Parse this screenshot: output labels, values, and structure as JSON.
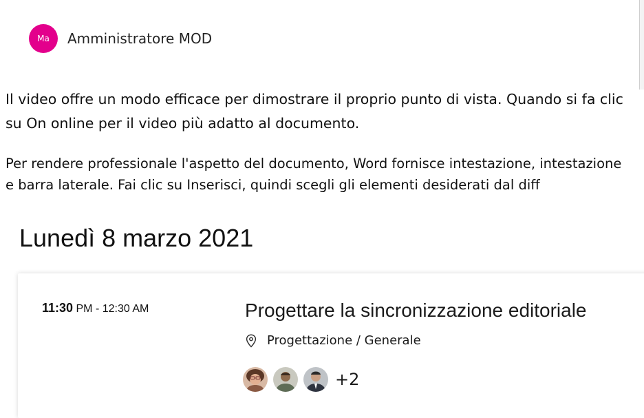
{
  "post": {
    "author": {
      "initials": "Ma",
      "name": "Amministratore MOD",
      "avatar_color": "#e3008c"
    },
    "paragraphs": [
      "Il video offre un modo efficace per dimostrare il proprio punto di vista. Quando si fa clic su On online per il video più adatto al documento.",
      "Per rendere professionale l'aspetto del documento, Word fornisce intestazione, intestazione e barra laterale. Fai clic su Inserisci, quindi scegli gli elementi desiderati dal diff"
    ]
  },
  "agenda": {
    "day": "Lunedì 8 marzo 2021",
    "event": {
      "start": "11:30",
      "start_suffix": "PM -",
      "end": "12:30 AM",
      "title": "Progettare la sincronizzazione editoriale",
      "location_icon": "location-pin-icon",
      "location": "Progettazione / Generale",
      "more_attendees": "+2"
    }
  }
}
